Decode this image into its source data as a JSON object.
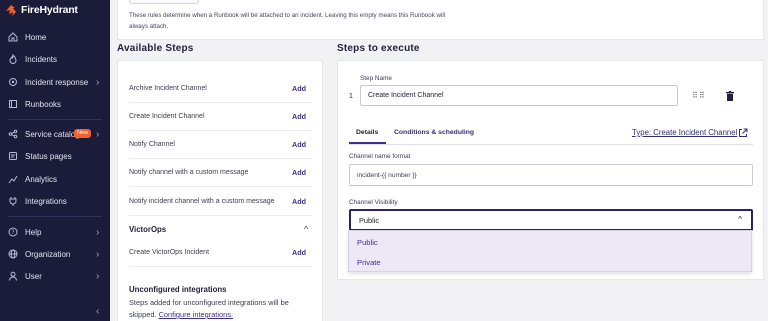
{
  "brand": {
    "name": "FireHydrant"
  },
  "sidebar": {
    "items": [
      {
        "label": "Home",
        "icon": "home-icon",
        "chevron": false
      },
      {
        "label": "Incidents",
        "icon": "flame-icon",
        "chevron": false
      },
      {
        "label": "Incident response",
        "icon": "response-icon",
        "chevron": true
      },
      {
        "label": "Runbooks",
        "icon": "book-icon",
        "chevron": false
      },
      {
        "label": "Service catalog",
        "icon": "catalog-icon",
        "chevron": true,
        "badge": "New"
      },
      {
        "label": "Status pages",
        "icon": "status-icon",
        "chevron": false
      },
      {
        "label": "Analytics",
        "icon": "analytics-icon",
        "chevron": false
      },
      {
        "label": "Integrations",
        "icon": "plug-icon",
        "chevron": false
      },
      {
        "label": "Help",
        "icon": "help-icon",
        "chevron": true
      },
      {
        "label": "Organization",
        "icon": "organization-icon",
        "chevron": true
      },
      {
        "label": "User",
        "icon": "user-icon",
        "chevron": true
      }
    ],
    "collapse_glyph": "‹"
  },
  "top_card": {
    "help_text": "These rules determine when a Runbook will be attached to an incident. Leaving this empty means this Runbook will always attach."
  },
  "available_steps": {
    "heading": "Available Steps",
    "add_label": "Add",
    "steps": [
      {
        "label": "Archive Incident Channel"
      },
      {
        "label": "Create Incident Channel"
      },
      {
        "label": "Notify Channel"
      },
      {
        "label": "Notify channel with a custom message"
      },
      {
        "label": "Notify incident channel with a custom message"
      }
    ],
    "group": {
      "title": "VictorOps",
      "steps": [
        {
          "label": "Create VictorOps Incident"
        }
      ]
    },
    "unconfigured": {
      "title": "Unconfigured integrations",
      "text": "Steps added for unconfigured integrations will be skipped.",
      "link": "Configure integrations."
    }
  },
  "execute": {
    "heading": "Steps to execute",
    "step_name_label": "Step Name",
    "step_number": "1",
    "step_name_value": "Create Incident Channel",
    "drag_glyph": "⠿⠿",
    "tabs": [
      {
        "label": "Details"
      },
      {
        "label": "Conditions & scheduling"
      }
    ],
    "type_link": "Type: Create Incident Channel",
    "channel_format_label": "Channel name format",
    "channel_format_value": "incident-{{ number }}",
    "visibility_label": "Channel Visibility",
    "visibility_value": "Public",
    "visibility_options": [
      "Public",
      "Private"
    ]
  },
  "colors": {
    "sidebar": "#1b1c3a",
    "accent": "#3e2e8e",
    "badge": "#f0622c"
  }
}
